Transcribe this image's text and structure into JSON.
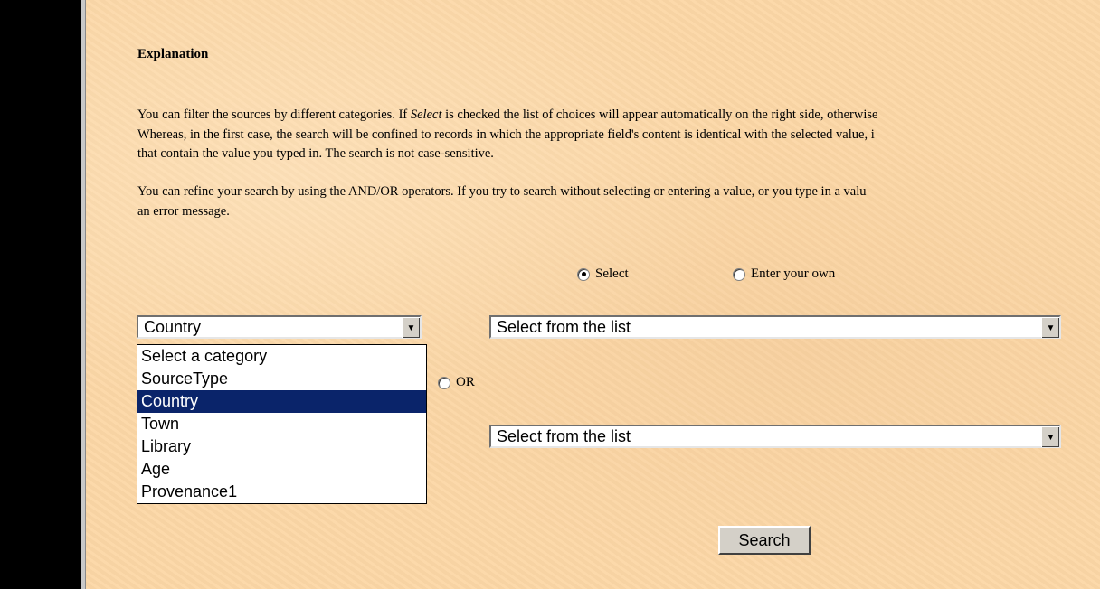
{
  "explanation": {
    "heading": "Explanation",
    "para1_line1_pre": "You can filter the sources by different categories. If ",
    "para1_line1_em": "Select",
    "para1_line1_post": " is checked the list of choices will appear automatically on the right side, otherwise",
    "para1_line2": "Whereas, in the first case, the search will be confined to records in which the appropriate field's content is identical with the selected value, i",
    "para1_line3": "that contain the value you typed in. The search is not case-sensitive.",
    "para2_line1": "You can refine your search by using the AND/OR operators. If you try to search without selecting or entering a value, or you type in a valu",
    "para2_line2": "an error message."
  },
  "mode": {
    "select_label": "Select",
    "own_label": "Enter your own",
    "selected": "Select"
  },
  "category": {
    "current": "Country",
    "options": [
      "Select a category",
      "SourceType",
      "Country",
      "Town",
      "Library",
      "Age",
      "Provenance1"
    ],
    "highlighted_index": 2
  },
  "operator": {
    "label": "OR"
  },
  "value_select_1": {
    "value": "Select from the list"
  },
  "value_select_2": {
    "value": "Select from the list"
  },
  "search_button": {
    "label": "Search"
  }
}
